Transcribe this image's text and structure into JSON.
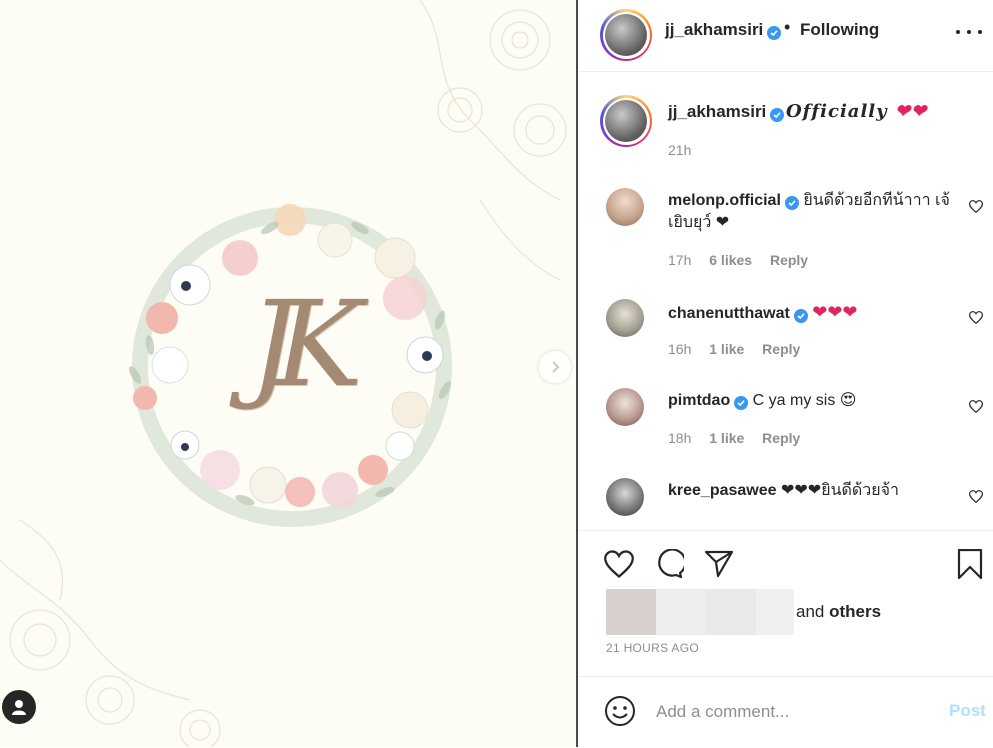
{
  "post_author": {
    "username": "jj_akhamsiri",
    "follow_status": "Following",
    "separator": "•"
  },
  "media": {
    "monogram": "JK",
    "has_next": true
  },
  "caption": {
    "username": "jj_akhamsiri",
    "text": "𝑶𝒇𝒇𝒊𝒄𝒊𝒂𝒍𝒍𝒚",
    "hearts": "❤❤",
    "time": "21h"
  },
  "comments": [
    {
      "username": "melonp.official",
      "verified": true,
      "text": "ยินดีด้วยอีกทีน้าาา เจ้ เยิบยุว์ ❤",
      "time": "17h",
      "likes": "6 likes",
      "reply": "Reply"
    },
    {
      "username": "chanenutthawat",
      "verified": true,
      "text": "❤❤❤",
      "time": "16h",
      "likes": "1 like",
      "reply": "Reply"
    },
    {
      "username": "pimtdao",
      "verified": true,
      "text": "C ya my sis 😍",
      "time": "18h",
      "likes": "1 like",
      "reply": "Reply"
    },
    {
      "username": "kree_pasawee",
      "verified": false,
      "text": "❤❤❤ยินดีด้วยจ้า",
      "time": "",
      "likes": "",
      "reply": ""
    }
  ],
  "likes": {
    "others_prefix": "and",
    "others_label": "others"
  },
  "timestamp": "21 HOURS AGO",
  "add_comment": {
    "placeholder": "Add a comment...",
    "post_label": "Post"
  },
  "colors": {
    "verified": "#3897f0",
    "heart": "#e0245e",
    "post_disabled": "#b2dffc"
  }
}
